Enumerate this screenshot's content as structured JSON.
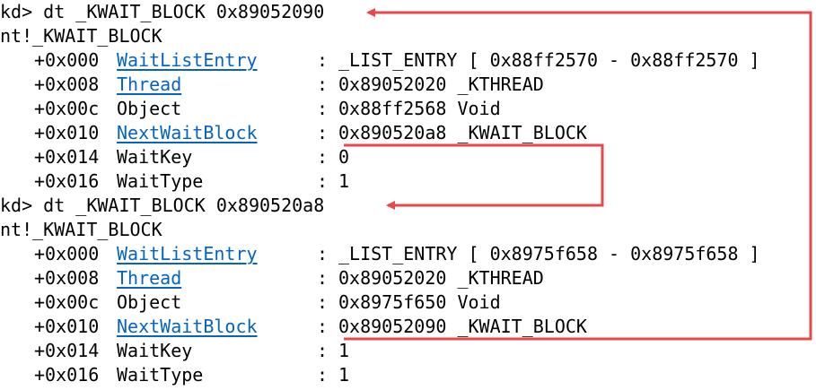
{
  "console": {
    "blocks": [
      {
        "command": "kd> dt _KWAIT_BLOCK 0x89052090",
        "type_name": "nt!_KWAIT_BLOCK",
        "fields": [
          {
            "offset": "+0x000",
            "name": "WaitListEntry",
            "is_link": true,
            "sep": ":",
            "value": "_LIST_ENTRY [ 0x88ff2570 - 0x88ff2570 ]"
          },
          {
            "offset": "+0x008",
            "name": "Thread",
            "is_link": true,
            "sep": ":",
            "value": "0x89052020 _KTHREAD"
          },
          {
            "offset": "+0x00c",
            "name": "Object",
            "is_link": false,
            "sep": ":",
            "value": "0x88ff2568 Void"
          },
          {
            "offset": "+0x010",
            "name": "NextWaitBlock",
            "is_link": true,
            "sep": ":",
            "value": "0x890520a8 _KWAIT_BLOCK"
          },
          {
            "offset": "+0x014",
            "name": "WaitKey",
            "is_link": false,
            "sep": ":",
            "value": "0"
          },
          {
            "offset": "+0x016",
            "name": "WaitType",
            "is_link": false,
            "sep": ":",
            "value": "1"
          }
        ]
      },
      {
        "command": "kd> dt _KWAIT_BLOCK 0x890520a8",
        "type_name": "nt!_KWAIT_BLOCK",
        "fields": [
          {
            "offset": "+0x000",
            "name": "WaitListEntry",
            "is_link": true,
            "sep": ":",
            "value": "_LIST_ENTRY [ 0x8975f658 - 0x8975f658 ]"
          },
          {
            "offset": "+0x008",
            "name": "Thread",
            "is_link": true,
            "sep": ":",
            "value": "0x89052020 _KTHREAD"
          },
          {
            "offset": "+0x00c",
            "name": "Object",
            "is_link": false,
            "sep": ":",
            "value": "0x8975f650 Void"
          },
          {
            "offset": "+0x010",
            "name": "NextWaitBlock",
            "is_link": true,
            "sep": ":",
            "value": "0x89052090 _KWAIT_BLOCK"
          },
          {
            "offset": "+0x014",
            "name": "WaitKey",
            "is_link": false,
            "sep": ":",
            "value": "1"
          },
          {
            "offset": "+0x016",
            "name": "WaitType",
            "is_link": false,
            "sep": ":",
            "value": "1"
          }
        ]
      }
    ]
  },
  "colors": {
    "text": "#000000",
    "link": "#0563c1",
    "arrow": "#e8474b",
    "background": "#ffffff"
  },
  "arrows": [
    {
      "name": "arrow-next-to-block-2",
      "from": "block1.NextWaitBlock",
      "to": "block2.command"
    },
    {
      "name": "arrow-next-to-block-1",
      "from": "block2.NextWaitBlock",
      "to": "block1.command"
    }
  ]
}
